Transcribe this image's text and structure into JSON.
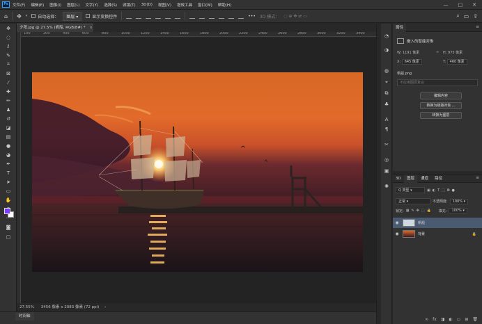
{
  "app": {
    "logo": "Ps"
  },
  "menu": [
    "文件(F)",
    "编辑(E)",
    "图像(I)",
    "图层(L)",
    "文字(Y)",
    "选择(S)",
    "滤镜(T)",
    "3D(D)",
    "视图(V)",
    "增效工具",
    "窗口(W)",
    "帮助(H)"
  ],
  "window_controls": {
    "minimize": "—",
    "maximize": "□",
    "close": "✕"
  },
  "options": {
    "home_icon": "⌂",
    "move_icon": "✥",
    "auto_select_label": "自动选择：",
    "auto_select_value": "图层",
    "transform_label": "显示变换控件",
    "more": "•••",
    "mode_3d_label": "3D 模式：",
    "right_icons": [
      "⌕",
      "▭",
      "⇪"
    ]
  },
  "doc": {
    "tab_label": "夕阳.jpg @ 27.5% (帆船, RGB/8#) *",
    "close": "×"
  },
  "ruler": {
    "h_labels": [
      "100",
      "200",
      "400",
      "600",
      "800",
      "1000",
      "1200",
      "1400",
      "1600",
      "1800",
      "2000",
      "2200",
      "2400",
      "2600",
      "2800",
      "3000",
      "3200",
      "3400"
    ]
  },
  "status": {
    "zoom": "27.55%",
    "info": "3456 像素 x 2083 像素 (72 ppi)",
    "arrow": "›"
  },
  "timeline": {
    "label": "时间轴"
  },
  "properties": {
    "tab": "属性",
    "menu_icon": "≡",
    "type_label": "嵌入的智能对象",
    "w_label": "W:",
    "w_value": "1191 像素",
    "h_label": "H:",
    "h_value": "975 像素",
    "x_label": "X:",
    "x_value": "645 像素",
    "y_label": "Y:",
    "y_value": "460 像素",
    "file_label": "帆船.png",
    "comp_placeholder": "不应用图层复合",
    "btn_edit": "编辑内容",
    "btn_convert_linked": "转换为链接对象 ...",
    "btn_convert_layers": "转换为图层"
  },
  "layers_panel": {
    "tabs": [
      "3D",
      "图层",
      "通道",
      "路径"
    ],
    "menu_icon": "≡",
    "filter_label": "Q 类型",
    "blend_mode": "正常",
    "opacity_label": "不透明度:",
    "opacity_value": "100%",
    "lock_label": "锁定:",
    "fill_label": "填充:",
    "fill_value": "100%",
    "layers": [
      {
        "name": "帆船",
        "selected": true
      },
      {
        "name": "背景",
        "selected": false,
        "locked": true
      }
    ],
    "bottom_icons": [
      "∞",
      "fx",
      "◨",
      "◐",
      "▭",
      "⊞",
      "🗑"
    ]
  },
  "colors": {
    "foreground": "#7a3cff",
    "background": "#ffffff",
    "accent": "#31a8ff"
  }
}
